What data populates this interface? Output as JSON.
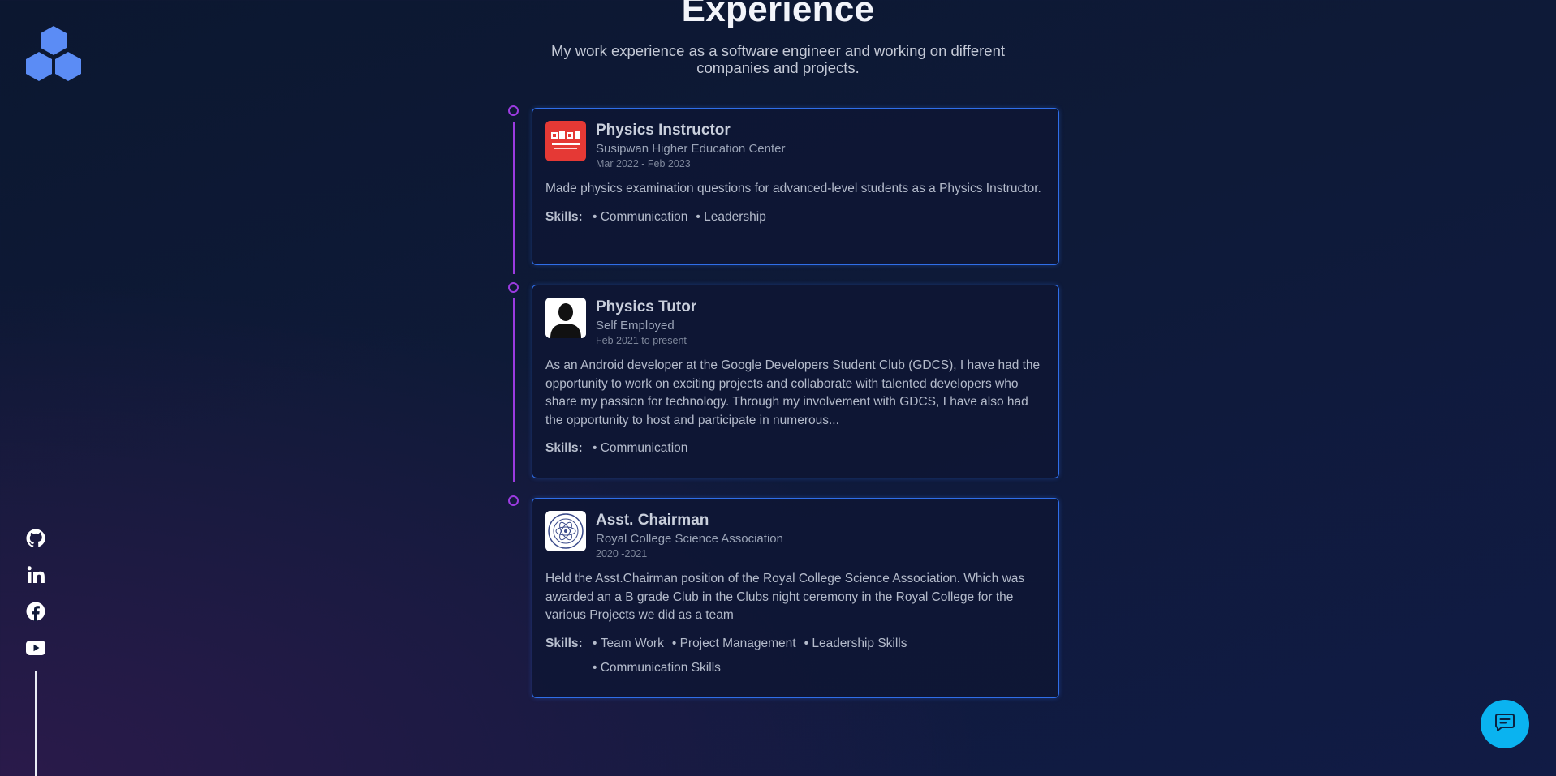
{
  "header": {
    "title": "Experience",
    "subtitle": "My work experience as a software engineer and working on different companies and projects."
  },
  "experiences": [
    {
      "title": "Physics Instructor",
      "org": "Susipwan Higher Education Center",
      "date": "Mar 2022 - Feb 2023",
      "description": "Made physics examination questions for advanced-level students as a Physics Instructor.",
      "skills_label": "Skills:",
      "skills": [
        "Communication",
        "Leadership"
      ],
      "logo_icon": "susipwan-logo-icon"
    },
    {
      "title": "Physics Tutor",
      "org": "Self Employed",
      "date": "Feb 2021 to present",
      "description": "As an Android developer at the Google Developers Student Club (GDCS), I have had the opportunity to work on exciting projects and collaborate with talented developers who share my passion for technology. Through my involvement with GDCS, I have also had the opportunity to host and participate in numerous...",
      "skills_label": "Skills:",
      "skills": [
        "Communication"
      ],
      "logo_icon": "person-silhouette-icon"
    },
    {
      "title": "Asst. Chairman",
      "org": "Royal College Science Association",
      "date": "2020 -2021",
      "description": "Held the Asst.Chairman position of the Royal College Science Association. Which was awarded an a B grade Club in the Clubs night ceremony in the Royal College for the various Projects we did as a team",
      "skills_label": "Skills:",
      "skills": [
        "Team Work",
        "Project Management",
        "Leadership Skills",
        "Communication Skills"
      ],
      "logo_icon": "science-association-seal-icon"
    }
  ],
  "social": [
    "github-icon",
    "linkedin-icon",
    "facebook-icon",
    "youtube-icon"
  ],
  "colors": {
    "accent_blue": "#2f6ee8",
    "timeline_purple": "#9b3be0",
    "logo_blue": "#5b8cf5",
    "chat_button": "#0ab3f0"
  }
}
